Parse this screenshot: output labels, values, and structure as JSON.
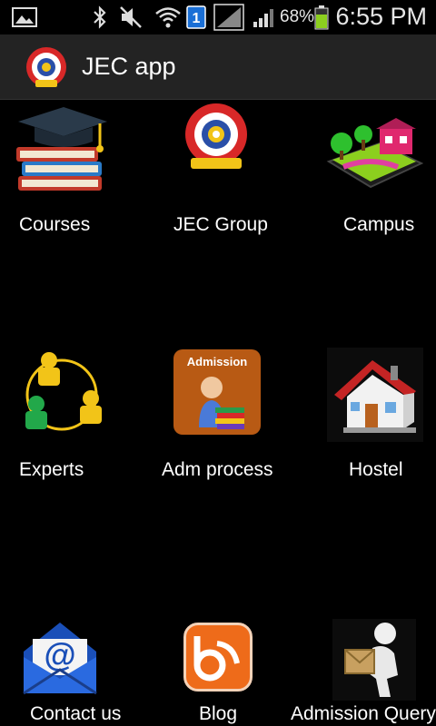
{
  "status_bar": {
    "battery_percent": "68%",
    "time": "6:55 PM",
    "notification_badge": "1",
    "icons": [
      "gallery-icon",
      "bluetooth-icon",
      "mute-icon",
      "wifi-icon",
      "sim-badge-icon",
      "signal-icon",
      "signal-icon",
      "battery-icon"
    ]
  },
  "action_bar": {
    "title": "JEC app",
    "logo": "jec-logo-icon"
  },
  "grid": {
    "items": [
      {
        "label": "Courses",
        "icon": "graduation-books-icon"
      },
      {
        "label": "JEC Group",
        "icon": "jec-emblem-icon"
      },
      {
        "label": "Campus",
        "icon": "campus-map-icon"
      },
      {
        "label": "Experts",
        "icon": "people-network-icon"
      },
      {
        "label": "Adm process",
        "icon": "admission-icon",
        "icon_text": "Admission"
      },
      {
        "label": "Hostel",
        "icon": "house-icon"
      },
      {
        "label": "Contact us",
        "icon": "email-icon"
      },
      {
        "label": "Blog",
        "icon": "blog-icon"
      },
      {
        "label": "Admission Query",
        "icon": "courier-icon"
      }
    ]
  },
  "colors": {
    "background": "#000000",
    "action_bar": "#232323",
    "admission_tile": "#b85a14",
    "blog_orange": "#ee6b1a"
  }
}
